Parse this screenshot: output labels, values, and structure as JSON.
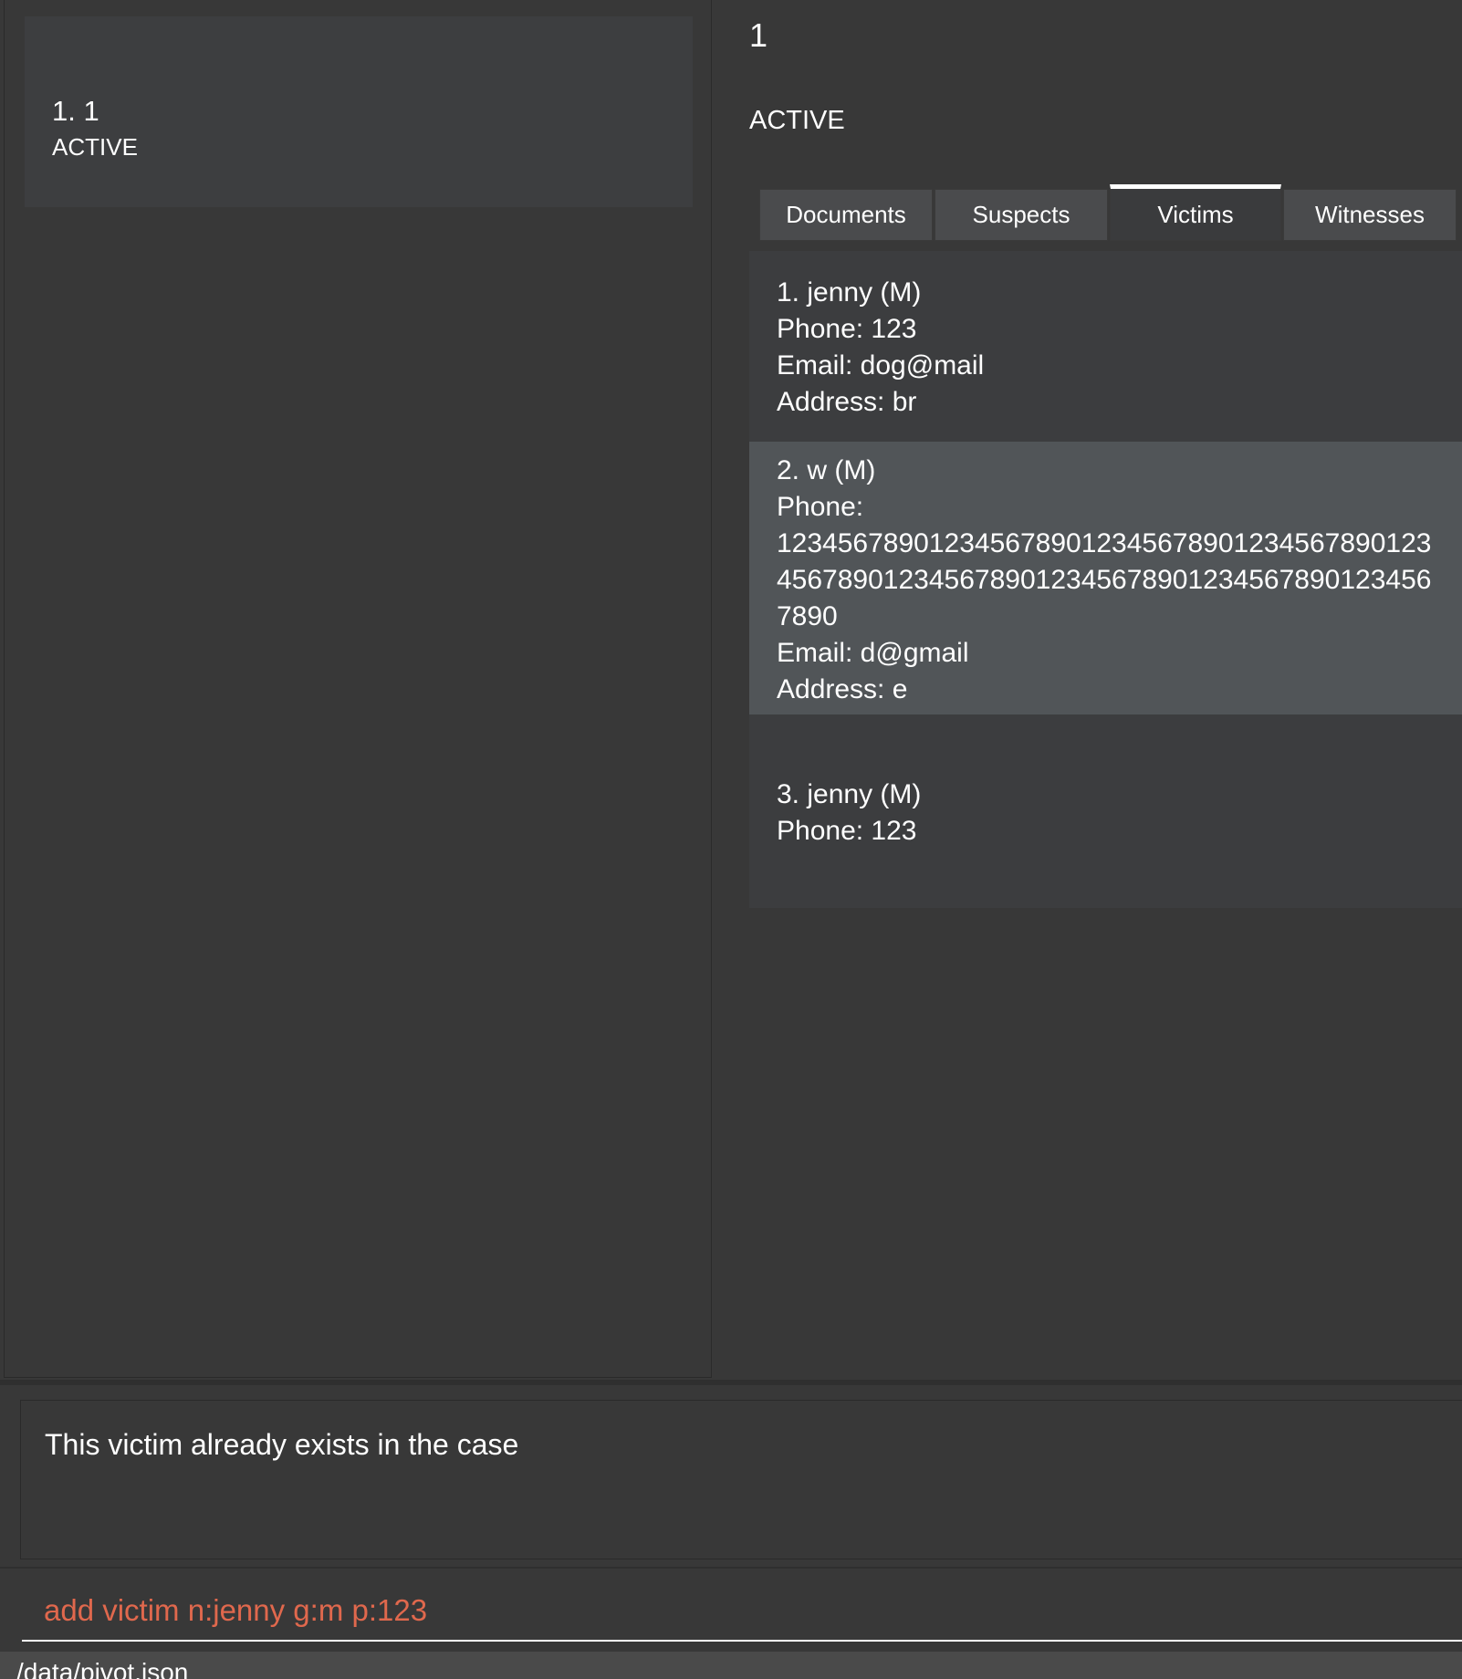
{
  "case_list": {
    "items": [
      {
        "index_title": "1.  1",
        "status": "ACTIVE"
      }
    ]
  },
  "case_detail": {
    "title": "1",
    "status": "ACTIVE",
    "tabs": [
      "Documents",
      "Suspects",
      "Victims",
      "Witnesses"
    ],
    "active_tab": "Victims",
    "victims": [
      {
        "header": "1.  jenny  (M)",
        "lines": [
          "Phone: 123",
          "Email: dog@mail",
          "Address: br"
        ]
      },
      {
        "header": "2.  w  (M)",
        "lines": [
          "Phone:",
          "1234567890123456789012345678901234567890123",
          "4567890123456789012345678901234567890123456",
          "7890",
          "Email: d@gmail",
          "Address: e"
        ]
      },
      {
        "header": "3.  jenny  (M)",
        "lines": [
          "Phone: 123"
        ]
      }
    ]
  },
  "result_display": {
    "message": "This victim already exists in the case"
  },
  "command_box": {
    "value": "add victim n:jenny g:m p:123"
  },
  "status_bar": {
    "path": "/data/pivot.json"
  },
  "colors": {
    "background": "#383838",
    "card": "#3d3e40",
    "selected_row": "#515558",
    "command_text": "#e0684d"
  }
}
